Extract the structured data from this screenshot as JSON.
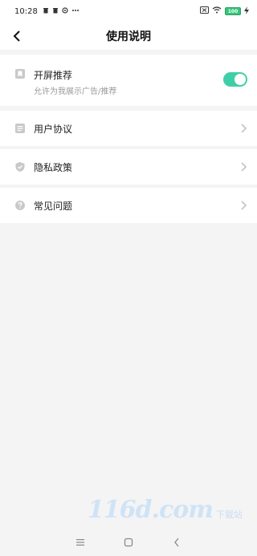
{
  "status_bar": {
    "time": "10:28",
    "icons_left": [
      "trash-icon",
      "trash-icon",
      "sync-icon",
      "more-dots-icon"
    ],
    "icons_right": [
      "sim-icon",
      "wifi-icon",
      "battery-icon",
      "charging-icon"
    ],
    "battery": "100"
  },
  "header": {
    "title": "使用说明",
    "back_icon": "chevron-left-icon"
  },
  "recommend": {
    "title": "开屏推荐",
    "subtitle": "允许为我展示广告/推荐",
    "icon": "bookmark-icon",
    "toggle_on": true,
    "accent": "#3ecfa8"
  },
  "menu": [
    {
      "label": "用户协议",
      "icon": "document-icon"
    },
    {
      "label": "隐私政策",
      "icon": "shield-icon"
    },
    {
      "label": "常见问题",
      "icon": "question-icon"
    }
  ],
  "watermark": {
    "brand": "116d.com",
    "sub": "下载站"
  },
  "nav": [
    "menu-icon",
    "home-icon",
    "back-icon"
  ]
}
